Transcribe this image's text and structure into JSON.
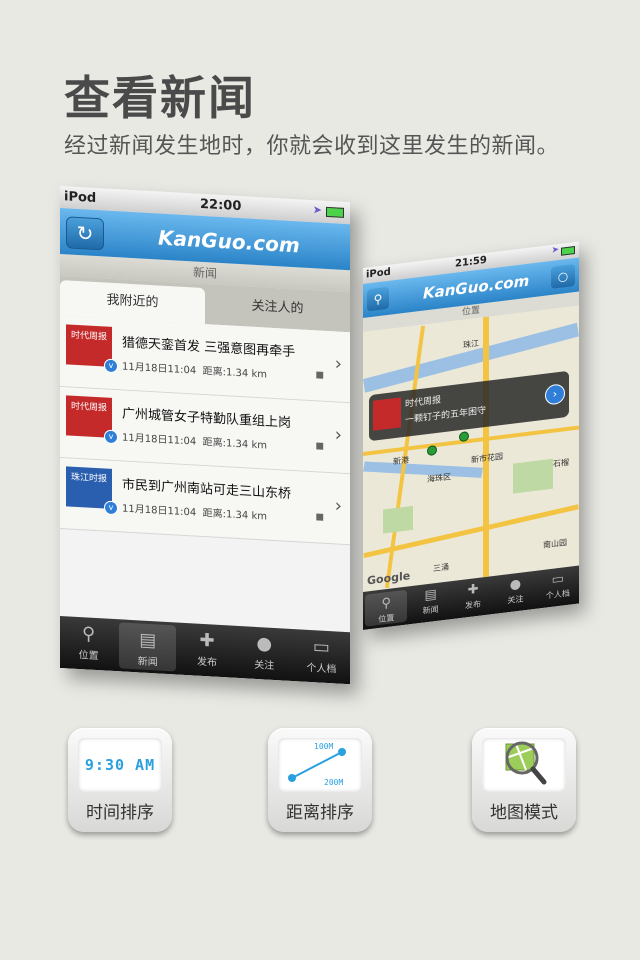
{
  "hero": {
    "title": "查看新闻",
    "subtitle": "经过新闻发生地时，你就会收到这里发生的新闻。"
  },
  "phone1": {
    "status": {
      "carrier": "iPod",
      "time": "22:00"
    },
    "nav": {
      "logo": "KanGuo.com",
      "refresh_icon": "refresh-icon"
    },
    "section": "新闻",
    "tabs": [
      {
        "label": "我附近的",
        "active": true
      },
      {
        "label": "关注人的",
        "active": false
      }
    ],
    "news": [
      {
        "thumb_text": "时代周报",
        "thumb_color": "#c52a2a",
        "headline": "猎德天銮首发 三强意图再牵手",
        "time": "11月18日11:04",
        "distance": "距离:1.34 km"
      },
      {
        "thumb_text": "时代周报",
        "thumb_color": "#c52a2a",
        "headline": "广州城管女子特勤队重组上岗",
        "time": "11月18日11:04",
        "distance": "距离:1.34 km"
      },
      {
        "thumb_text": "珠江时报",
        "thumb_color": "#2a5fb0",
        "headline": "市民到广州南站可走三山东桥",
        "time": "11月18日11:04",
        "distance": "距离:1.34 km"
      }
    ],
    "tabbar": [
      {
        "label": "位置",
        "icon": "pin-icon"
      },
      {
        "label": "新闻",
        "icon": "newspaper-icon",
        "selected": true
      },
      {
        "label": "发布",
        "icon": "speech-plus-icon"
      },
      {
        "label": "关注",
        "icon": "person-icon"
      },
      {
        "label": "个人档",
        "icon": "id-card-icon"
      }
    ]
  },
  "phone2": {
    "status": {
      "carrier": "iPod",
      "time": "21:59"
    },
    "nav": {
      "logo": "KanGuo.com"
    },
    "section": "位置",
    "callout": {
      "source": "时代周报",
      "headline": "一颗钉子的五年困守"
    },
    "map_labels": {
      "district": "海珠区",
      "area1": "珠江",
      "area2": "新港",
      "area3": "石榴",
      "area4": "南山园",
      "area5": "三涌",
      "area6": "新市花园",
      "google": "Google"
    },
    "tabbar": [
      {
        "label": "位置",
        "icon": "pin-icon",
        "selected": true
      },
      {
        "label": "新闻",
        "icon": "newspaper-icon"
      },
      {
        "label": "发布",
        "icon": "speech-plus-icon"
      },
      {
        "label": "关注",
        "icon": "person-icon"
      },
      {
        "label": "个人档",
        "icon": "id-card-icon"
      }
    ]
  },
  "features": [
    {
      "label": "时间排序",
      "art_text": "9:30 AM"
    },
    {
      "label": "距离排序",
      "art_top": "100M",
      "art_bottom": "200M"
    },
    {
      "label": "地图模式"
    }
  ]
}
